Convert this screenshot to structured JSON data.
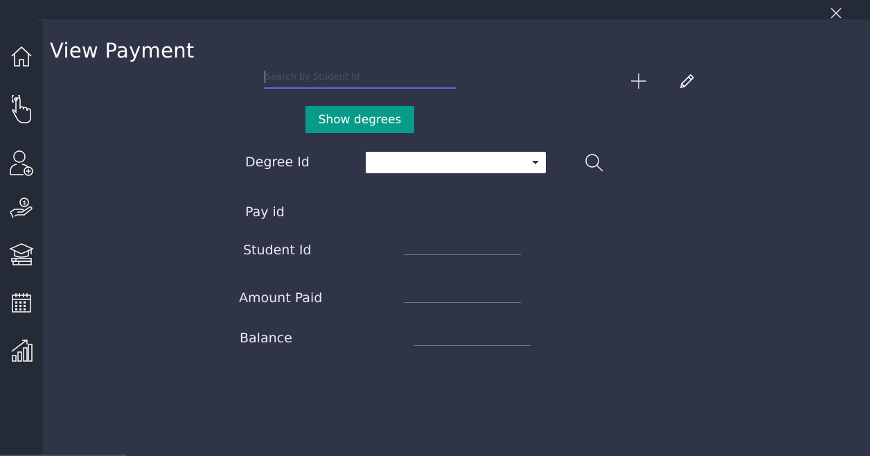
{
  "window": {
    "close_icon": "close-icon"
  },
  "sidebar": {
    "items": [
      {
        "id": "home",
        "icon": "home-icon"
      },
      {
        "id": "tap",
        "icon": "touch-gesture-icon"
      },
      {
        "id": "add-user",
        "icon": "add-user-icon"
      },
      {
        "id": "payment",
        "icon": "money-hand-icon"
      },
      {
        "id": "degree",
        "icon": "graduation-cap-books-icon"
      },
      {
        "id": "calendar",
        "icon": "calendar-icon"
      },
      {
        "id": "reports",
        "icon": "growth-chart-icon"
      }
    ]
  },
  "page": {
    "title": "View Payment"
  },
  "search": {
    "placeholder": "Search by Student Id",
    "value": ""
  },
  "toolbar": {
    "add_icon": "plus-icon",
    "edit_icon": "pencil-icon"
  },
  "show_degrees_button": {
    "label": "Show degrees"
  },
  "form": {
    "degree_id": {
      "label": "Degree Id",
      "selected": ""
    },
    "search_icon": "search-icon",
    "pay_id": {
      "label": "Pay id",
      "value": ""
    },
    "student_id": {
      "label": "Student Id",
      "value": ""
    },
    "amount_paid": {
      "label": "Amount Paid",
      "value": ""
    },
    "balance": {
      "label": "Balance",
      "value": ""
    }
  },
  "colors": {
    "background": "#2f3447",
    "sidebar": "#252a37",
    "accent": "#079b8a",
    "input_underline": "#5868d6",
    "text": "#ffffff"
  }
}
